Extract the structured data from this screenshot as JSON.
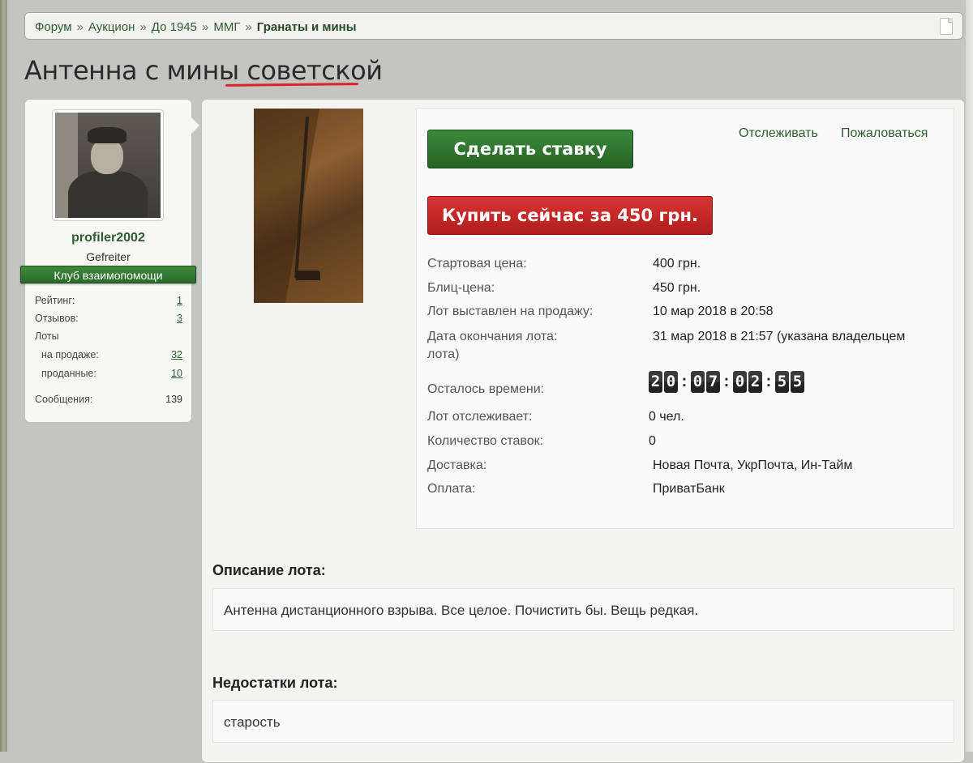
{
  "breadcrumb": {
    "items": [
      "Форум",
      "Аукцион",
      "До 1945",
      "ММГ"
    ],
    "current": "Гранаты и мины",
    "separator": "»"
  },
  "page": {
    "title": "Антенна с мины советской"
  },
  "user": {
    "name": "profiler2002",
    "rank": "Gefreiter",
    "club": "Клуб взаимопомощи",
    "stats": {
      "rating_label": "Рейтинг:",
      "rating": "1",
      "reviews_label": "Отзывов:",
      "reviews": "3",
      "lots_label": "Лоты",
      "on_sale_label": "на продаже:",
      "on_sale": "32",
      "sold_label": "проданные:",
      "sold": "10",
      "messages_label": "Сообщения:",
      "messages": "139"
    }
  },
  "lot": {
    "bid_button": "Сделать ставку",
    "buy_button": "Купить сейчас за 450 грн.",
    "watch_link": "Отслеживать",
    "report_link": "Пожаловаться",
    "fields": {
      "start_price_label": "Стартовая цена:",
      "start_price": "400 грн.",
      "blitz_price_label": "Блиц-цена:",
      "blitz_price": "450 грн.",
      "listed_label": "Лот выставлен на продажу:",
      "listed": "10 мар 2018 в 20:58",
      "end_label": "Дата окончания лота:",
      "end": "31 мар 2018 в 21:57 (указана владельцем",
      "end_suffix": "лота)",
      "remaining_label": "Осталось времени:",
      "watchers_label": "Лот отслеживает:",
      "watchers": "0 чел.",
      "bids_label": "Количество ставок:",
      "bids": "0",
      "delivery_label": "Доставка:",
      "delivery": "Новая Почта, УкрПочта, Ин-Тайм",
      "payment_label": "Оплата:",
      "payment": "ПриватБанк"
    },
    "timer": {
      "d1": "2",
      "d2": "0",
      "d3": "0",
      "d4": "7",
      "d5": "0",
      "d6": "2",
      "d7": "5",
      "d8": "5",
      "sep": ":"
    },
    "description_title": "Описание лота:",
    "description": "Антенна дистанционного взрыва. Все целое. Почистить бы. Вещь редкая.",
    "defects_title": "Недостатки лота:",
    "defects": "старость"
  }
}
